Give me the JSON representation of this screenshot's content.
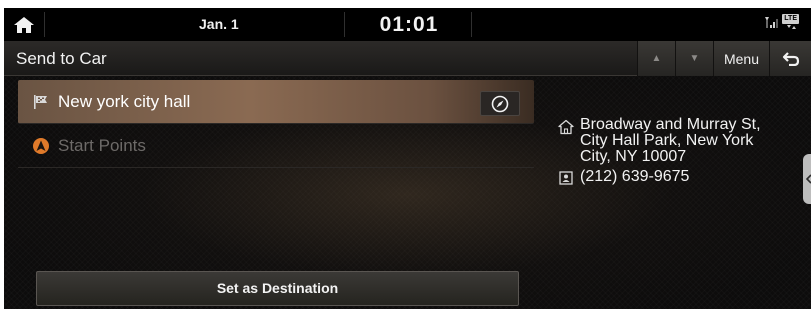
{
  "status_bar": {
    "date": "Jan. 1",
    "time": "01:01",
    "icons": [
      "home-icon",
      "signal-icon",
      "lte-icon"
    ],
    "lte_label": "LTE"
  },
  "header": {
    "title": "Send to Car",
    "menu_label": "Menu",
    "buttons": [
      "up-arrow-icon",
      "down-arrow-icon",
      "menu",
      "back-icon"
    ]
  },
  "list": {
    "items": [
      {
        "label": "New york city hall",
        "icon": "flag-icon",
        "selected": true
      },
      {
        "label": "Start Points",
        "icon": "compass-a-icon",
        "disabled": true
      }
    ]
  },
  "info": {
    "address_lines": [
      "Broadway and Murray St,",
      "City Hall Park, New York",
      "City, NY 10007"
    ],
    "phone": "(212) 639-9675"
  },
  "actions": {
    "set_destination": "Set as Destination"
  },
  "colors": {
    "selected_row": "#8a6a52",
    "background": "#0d0c0c",
    "disabled_text": "#6d6a68",
    "compass_orange": "#e07a2a"
  }
}
